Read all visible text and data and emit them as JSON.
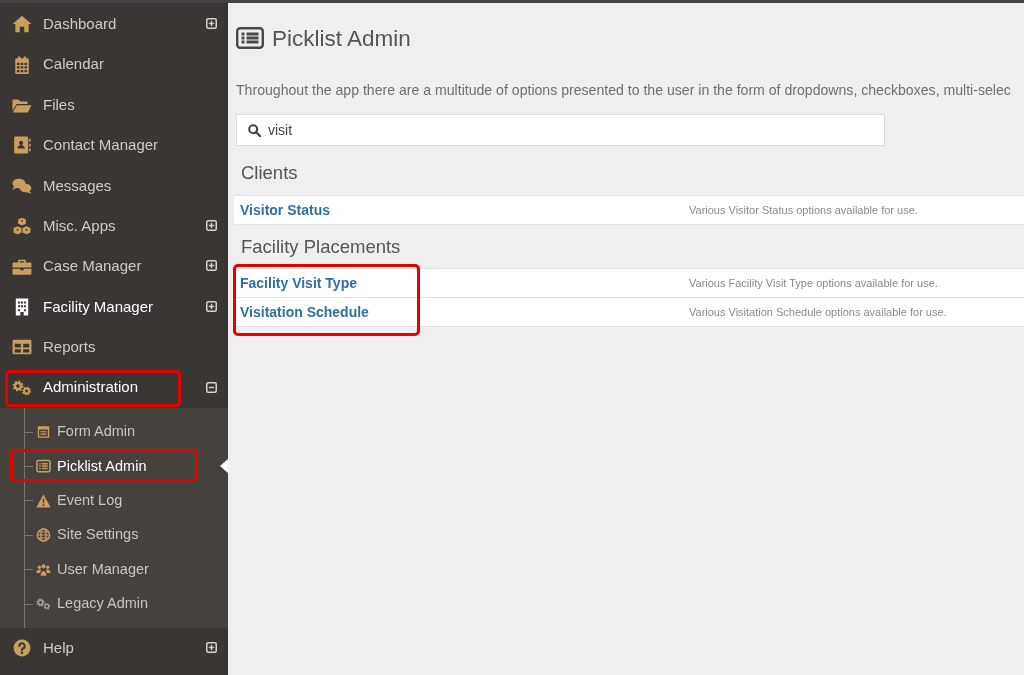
{
  "sidebar": {
    "items": [
      {
        "label": "Dashboard",
        "has_submenu": true,
        "expanded": false,
        "hovered": false,
        "highlighted": false
      },
      {
        "label": "Calendar",
        "has_submenu": false,
        "expanded": false,
        "hovered": false,
        "highlighted": false
      },
      {
        "label": "Files",
        "has_submenu": false,
        "expanded": false,
        "hovered": false,
        "highlighted": false
      },
      {
        "label": "Contact Manager",
        "has_submenu": false,
        "expanded": false,
        "hovered": false,
        "highlighted": false
      },
      {
        "label": "Messages",
        "has_submenu": false,
        "expanded": false,
        "hovered": false,
        "highlighted": false
      },
      {
        "label": "Misc. Apps",
        "has_submenu": true,
        "expanded": false,
        "hovered": false,
        "highlighted": false
      },
      {
        "label": "Case Manager",
        "has_submenu": true,
        "expanded": false,
        "hovered": false,
        "highlighted": false
      },
      {
        "label": "Facility Manager",
        "has_submenu": true,
        "expanded": false,
        "hovered": true,
        "highlighted": false
      },
      {
        "label": "Reports",
        "has_submenu": false,
        "expanded": false,
        "hovered": false,
        "highlighted": false
      },
      {
        "label": "Administration",
        "has_submenu": true,
        "expanded": true,
        "hovered": false,
        "highlighted": true,
        "children": [
          {
            "label": "Form Admin",
            "selected": false,
            "highlighted": false
          },
          {
            "label": "Picklist Admin",
            "selected": true,
            "highlighted": true
          },
          {
            "label": "Event Log",
            "selected": false,
            "highlighted": false
          },
          {
            "label": "Site Settings",
            "selected": false,
            "highlighted": false
          },
          {
            "label": "User Manager",
            "selected": false,
            "highlighted": false
          },
          {
            "label": "Legacy Admin",
            "selected": false,
            "highlighted": false
          }
        ]
      },
      {
        "label": "Help",
        "has_submenu": true,
        "expanded": false,
        "hovered": false,
        "highlighted": false
      }
    ]
  },
  "page": {
    "title": "Picklist Admin",
    "description": "Throughout the app there are a multitude of options presented to the user in the form of dropdowns, checkboxes, multi-selec",
    "search": {
      "value": "visit"
    },
    "sections": [
      {
        "heading": "Clients",
        "highlighted": false,
        "rows": [
          {
            "name": "Visitor Status",
            "description": "Various Visitor Status options available for use."
          }
        ]
      },
      {
        "heading": "Facility Placements",
        "highlighted": true,
        "rows": [
          {
            "name": "Facility Visit Type",
            "description": "Various Facility Visit Type options available for use."
          },
          {
            "name": "Visitation Schedule",
            "description": "Various Visitation Schedule options available for use."
          }
        ]
      }
    ]
  }
}
